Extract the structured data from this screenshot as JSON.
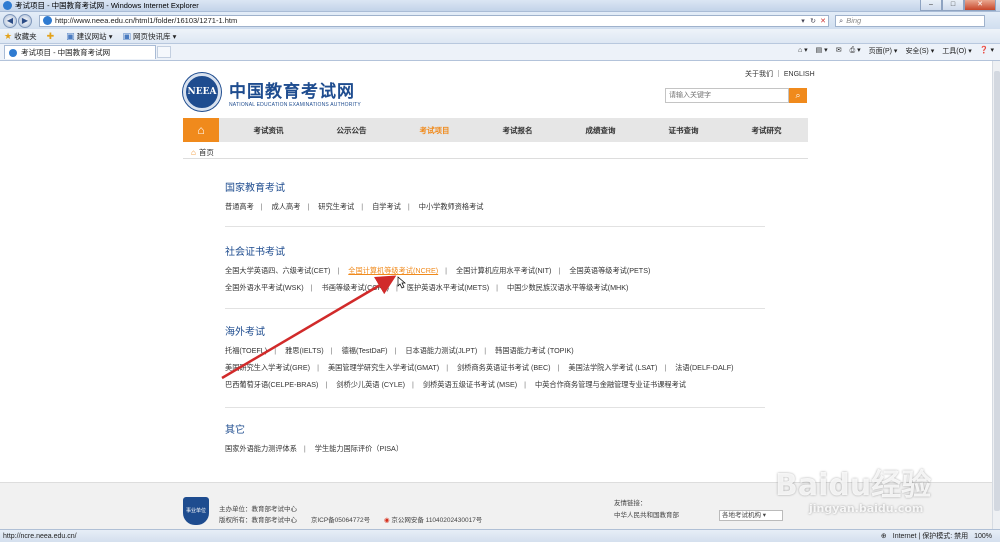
{
  "browser": {
    "window_title": "考试项目 - 中国教育考试网 - Windows Internet Explorer",
    "url": "http://www.neea.edu.cn/html1/folder/16103/1271-1.htm",
    "search_placeholder": "Bing",
    "favorites_label": "收藏夹",
    "fav_items": [
      "建议网站 ▾",
      "网页快讯库 ▾"
    ],
    "tab_title": "考试项目 - 中国教育考试网",
    "commands": [
      "页面(P) ▾",
      "安全(S) ▾",
      "工具(O) ▾",
      "❓ ▾"
    ],
    "status_url": "http://ncre.neea.edu.cn/",
    "status_zone": "Internet | 保护模式: 禁用",
    "zoom": "100%"
  },
  "site": {
    "toplinks": "关于我们 ｜ ENGLISH",
    "logo_initials": "NEEA",
    "logo_cn": "中国教育考试网",
    "logo_en": "NATIONAL EDUCATION EXAMINATIONS AUTHORITY",
    "search_placeholder": "请输入关键字",
    "nav": [
      "考试资讯",
      "公示公告",
      "考试项目",
      "考试报名",
      "成绩查询",
      "证书查询",
      "考试研究"
    ],
    "breadcrumb": "首页"
  },
  "sections": [
    {
      "title": "国家教育考试",
      "rows": [
        [
          "普通高考",
          "成人高考",
          "研究生考试",
          "自学考试",
          "中小学教师资格考试"
        ]
      ]
    },
    {
      "title": "社会证书考试",
      "rows": [
        [
          "全国大学英语四、六级考试(CET)",
          "全国计算机等级考试(NCRE)",
          "全国计算机应用水平考试(NIT)",
          "全国英语等级考试(PETS)"
        ],
        [
          "全国外语水平考试(WSK)",
          "书画等级考试(CCPT)",
          "医护英语水平考试(METS)",
          "中国少数民族汉语水平等级考试(MHK)"
        ]
      ]
    },
    {
      "title": "海外考试",
      "rows": [
        [
          "托福(TOEFL)",
          "雅思(IELTS)",
          "德福(TestDaF)",
          "日本语能力测试(JLPT)",
          "韩国语能力考试 (TOPIK)"
        ],
        [
          "美国研究生入学考试(GRE)",
          "美国管理学研究生入学考试(GMAT)",
          "剑桥商务英语证书考试 (BEC)",
          "美国法学院入学考试 (LSAT)",
          "法语(DELF-DALF)"
        ],
        [
          "巴西葡萄牙语(CELPE-BRAS)",
          "剑桥少儿英语 (CYLE)",
          "剑桥英语五级证书考试 (MSE)",
          "中英合作商务管理与金融管理专业证书课程考试"
        ]
      ]
    },
    {
      "title": "其它",
      "rows": [
        [
          "国家外语能力测评体系",
          "学生能力国际评价（PISA）"
        ]
      ]
    }
  ],
  "footer": {
    "badge": "事业单位",
    "sponsor": "主办单位：教育部考试中心",
    "copyright": "版权所有：教育部考试中心",
    "icp": "京ICP备05064772号",
    "police": "京公网安备 11040202430017号",
    "links_label": "友情链接：",
    "links_item": "中华人民共和国教育部",
    "select_value": "各地考试机构 ▾"
  },
  "watermark": {
    "brand": "Baidu经验",
    "url": "jingyan.baidu.com"
  },
  "colors": {
    "accent": "#f08a1c",
    "brand": "#1e4c8f",
    "arrow": "#d12a2a"
  }
}
